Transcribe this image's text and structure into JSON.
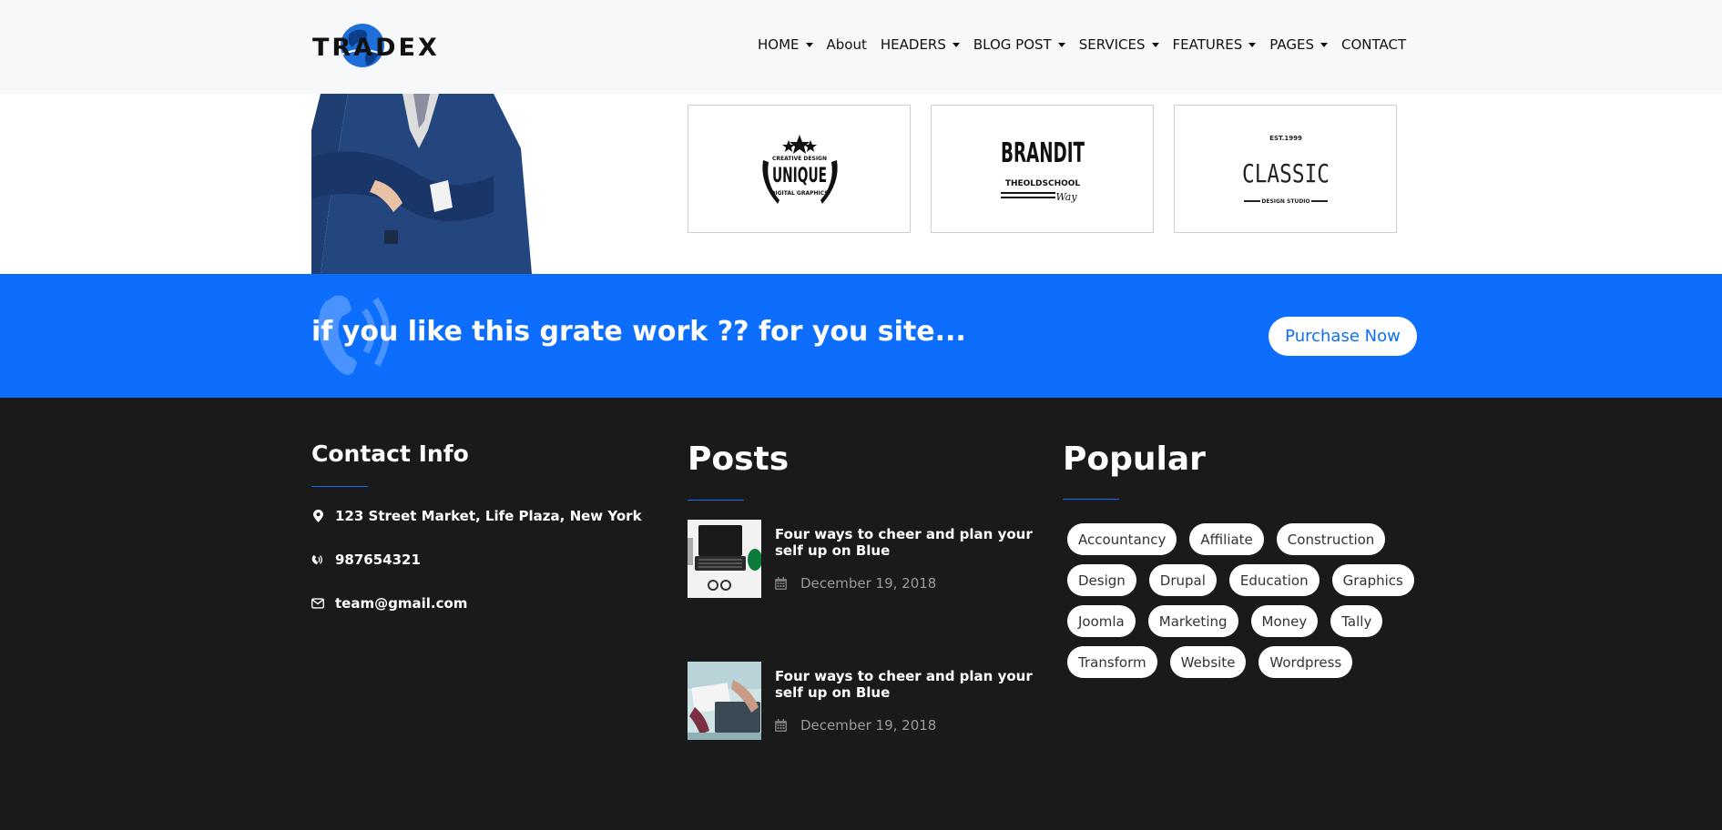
{
  "brand": {
    "name": "TRADEX"
  },
  "nav": {
    "items": [
      {
        "label": "HOME",
        "has_dropdown": true
      },
      {
        "label": "About",
        "has_dropdown": false
      },
      {
        "label": "HEADERS",
        "has_dropdown": true
      },
      {
        "label": "BLOG POST",
        "has_dropdown": true
      },
      {
        "label": "SERVICES",
        "has_dropdown": true
      },
      {
        "label": "FEATURES",
        "has_dropdown": true
      },
      {
        "label": "PAGES",
        "has_dropdown": true
      },
      {
        "label": "CONTACT",
        "has_dropdown": false
      }
    ]
  },
  "clients": [
    {
      "top": "CREATIVE DESIGN",
      "name": "UNIQUE",
      "sub": "DIGITAL GRAPHICS"
    },
    {
      "name": "BRANDIT",
      "sub": "THEOLDSCHOOL",
      "script": "Way"
    },
    {
      "top": "EST.1999",
      "name": "CLASSIC",
      "sub": "DESIGN STUDIO"
    }
  ],
  "cta": {
    "text": "if you like this grate work ?? for you site...",
    "button_label": "Purchase Now"
  },
  "footer": {
    "contact": {
      "title": "Contact Info",
      "address": "123 Street Market, Life Plaza, New York",
      "phone": "987654321",
      "email": "team@gmail.com"
    },
    "posts": {
      "title": "Posts",
      "items": [
        {
          "title": "Four ways to cheer and plan your self up on Blue",
          "date": "December 19, 2018"
        },
        {
          "title": "Four ways to cheer and plan your self up on Blue",
          "date": "December 19, 2018"
        }
      ]
    },
    "popular": {
      "title": "Popular",
      "tags": [
        [
          "Accountancy",
          "Affiliate",
          "Construction"
        ],
        [
          "Design",
          "Drupal",
          "Education",
          "Graphics"
        ],
        [
          "Joomla",
          "Marketing",
          "Money",
          "Tally"
        ],
        [
          "Transform",
          "Website",
          "Wordpress"
        ]
      ]
    }
  },
  "colors": {
    "accent": "#0d6efd",
    "footer_bg": "#1a1a1b",
    "header_bg": "#f7f8f9"
  }
}
